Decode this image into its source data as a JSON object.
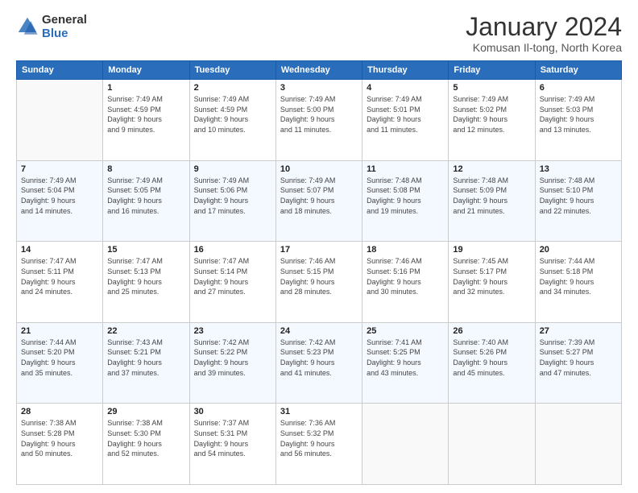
{
  "logo": {
    "line1": "General",
    "line2": "Blue"
  },
  "title": "January 2024",
  "subtitle": "Komusan Il-tong, North Korea",
  "header_days": [
    "Sunday",
    "Monday",
    "Tuesday",
    "Wednesday",
    "Thursday",
    "Friday",
    "Saturday"
  ],
  "weeks": [
    [
      {
        "day": "",
        "info": ""
      },
      {
        "day": "1",
        "info": "Sunrise: 7:49 AM\nSunset: 4:59 PM\nDaylight: 9 hours\nand 9 minutes."
      },
      {
        "day": "2",
        "info": "Sunrise: 7:49 AM\nSunset: 4:59 PM\nDaylight: 9 hours\nand 10 minutes."
      },
      {
        "day": "3",
        "info": "Sunrise: 7:49 AM\nSunset: 5:00 PM\nDaylight: 9 hours\nand 11 minutes."
      },
      {
        "day": "4",
        "info": "Sunrise: 7:49 AM\nSunset: 5:01 PM\nDaylight: 9 hours\nand 11 minutes."
      },
      {
        "day": "5",
        "info": "Sunrise: 7:49 AM\nSunset: 5:02 PM\nDaylight: 9 hours\nand 12 minutes."
      },
      {
        "day": "6",
        "info": "Sunrise: 7:49 AM\nSunset: 5:03 PM\nDaylight: 9 hours\nand 13 minutes."
      }
    ],
    [
      {
        "day": "7",
        "info": "Sunrise: 7:49 AM\nSunset: 5:04 PM\nDaylight: 9 hours\nand 14 minutes."
      },
      {
        "day": "8",
        "info": "Sunrise: 7:49 AM\nSunset: 5:05 PM\nDaylight: 9 hours\nand 16 minutes."
      },
      {
        "day": "9",
        "info": "Sunrise: 7:49 AM\nSunset: 5:06 PM\nDaylight: 9 hours\nand 17 minutes."
      },
      {
        "day": "10",
        "info": "Sunrise: 7:49 AM\nSunset: 5:07 PM\nDaylight: 9 hours\nand 18 minutes."
      },
      {
        "day": "11",
        "info": "Sunrise: 7:48 AM\nSunset: 5:08 PM\nDaylight: 9 hours\nand 19 minutes."
      },
      {
        "day": "12",
        "info": "Sunrise: 7:48 AM\nSunset: 5:09 PM\nDaylight: 9 hours\nand 21 minutes."
      },
      {
        "day": "13",
        "info": "Sunrise: 7:48 AM\nSunset: 5:10 PM\nDaylight: 9 hours\nand 22 minutes."
      }
    ],
    [
      {
        "day": "14",
        "info": "Sunrise: 7:47 AM\nSunset: 5:11 PM\nDaylight: 9 hours\nand 24 minutes."
      },
      {
        "day": "15",
        "info": "Sunrise: 7:47 AM\nSunset: 5:13 PM\nDaylight: 9 hours\nand 25 minutes."
      },
      {
        "day": "16",
        "info": "Sunrise: 7:47 AM\nSunset: 5:14 PM\nDaylight: 9 hours\nand 27 minutes."
      },
      {
        "day": "17",
        "info": "Sunrise: 7:46 AM\nSunset: 5:15 PM\nDaylight: 9 hours\nand 28 minutes."
      },
      {
        "day": "18",
        "info": "Sunrise: 7:46 AM\nSunset: 5:16 PM\nDaylight: 9 hours\nand 30 minutes."
      },
      {
        "day": "19",
        "info": "Sunrise: 7:45 AM\nSunset: 5:17 PM\nDaylight: 9 hours\nand 32 minutes."
      },
      {
        "day": "20",
        "info": "Sunrise: 7:44 AM\nSunset: 5:18 PM\nDaylight: 9 hours\nand 34 minutes."
      }
    ],
    [
      {
        "day": "21",
        "info": "Sunrise: 7:44 AM\nSunset: 5:20 PM\nDaylight: 9 hours\nand 35 minutes."
      },
      {
        "day": "22",
        "info": "Sunrise: 7:43 AM\nSunset: 5:21 PM\nDaylight: 9 hours\nand 37 minutes."
      },
      {
        "day": "23",
        "info": "Sunrise: 7:42 AM\nSunset: 5:22 PM\nDaylight: 9 hours\nand 39 minutes."
      },
      {
        "day": "24",
        "info": "Sunrise: 7:42 AM\nSunset: 5:23 PM\nDaylight: 9 hours\nand 41 minutes."
      },
      {
        "day": "25",
        "info": "Sunrise: 7:41 AM\nSunset: 5:25 PM\nDaylight: 9 hours\nand 43 minutes."
      },
      {
        "day": "26",
        "info": "Sunrise: 7:40 AM\nSunset: 5:26 PM\nDaylight: 9 hours\nand 45 minutes."
      },
      {
        "day": "27",
        "info": "Sunrise: 7:39 AM\nSunset: 5:27 PM\nDaylight: 9 hours\nand 47 minutes."
      }
    ],
    [
      {
        "day": "28",
        "info": "Sunrise: 7:38 AM\nSunset: 5:28 PM\nDaylight: 9 hours\nand 50 minutes."
      },
      {
        "day": "29",
        "info": "Sunrise: 7:38 AM\nSunset: 5:30 PM\nDaylight: 9 hours\nand 52 minutes."
      },
      {
        "day": "30",
        "info": "Sunrise: 7:37 AM\nSunset: 5:31 PM\nDaylight: 9 hours\nand 54 minutes."
      },
      {
        "day": "31",
        "info": "Sunrise: 7:36 AM\nSunset: 5:32 PM\nDaylight: 9 hours\nand 56 minutes."
      },
      {
        "day": "",
        "info": ""
      },
      {
        "day": "",
        "info": ""
      },
      {
        "day": "",
        "info": ""
      }
    ]
  ]
}
